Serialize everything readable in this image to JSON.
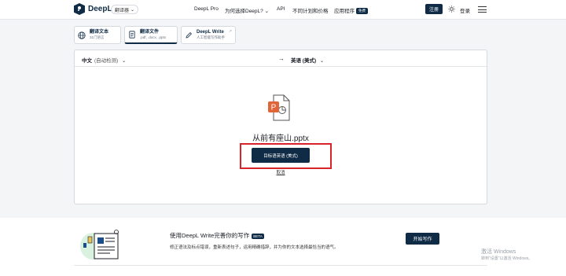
{
  "header": {
    "brand": "DeepL",
    "tool_switcher": "翻译器",
    "nav": {
      "pro": "DeepL Pro",
      "why": "为何选择DeepL?",
      "api": "API",
      "plans": "不同计划和价格",
      "apps": "应用程序",
      "apps_badge": "免费"
    },
    "signup": "注册",
    "login": "登录"
  },
  "tabs": [
    {
      "title": "翻译文本",
      "subtitle": "31门语言"
    },
    {
      "title": "翻译文件",
      "subtitle": ".pdf, .docx, .pptx"
    },
    {
      "title": "DeepL Write",
      "subtitle": "人工智能写作助手"
    }
  ],
  "translator": {
    "source_lang": "中文",
    "source_auto": "(自动检测)",
    "target_lang": "英语 (美式)",
    "file_name": "从前有座山.pptx",
    "translate_button": "目标语英语 (美式)",
    "cancel": "取消"
  },
  "promo": {
    "title": "使用DeepL Write完善你的写作",
    "badge": "BETA",
    "description": "修正语法及标点错误，重新表述句子，运用精确措辞，并为你的文本选择最恰当的语气。",
    "button": "开始写作"
  },
  "watermark": {
    "title": "激活 Windows",
    "subtitle": "转到\"设置\"以激活 Windows。"
  },
  "colors": {
    "brand_navy": "#0f2b46",
    "highlight_red": "#d8232a",
    "pptx_orange": "#e0663a"
  }
}
